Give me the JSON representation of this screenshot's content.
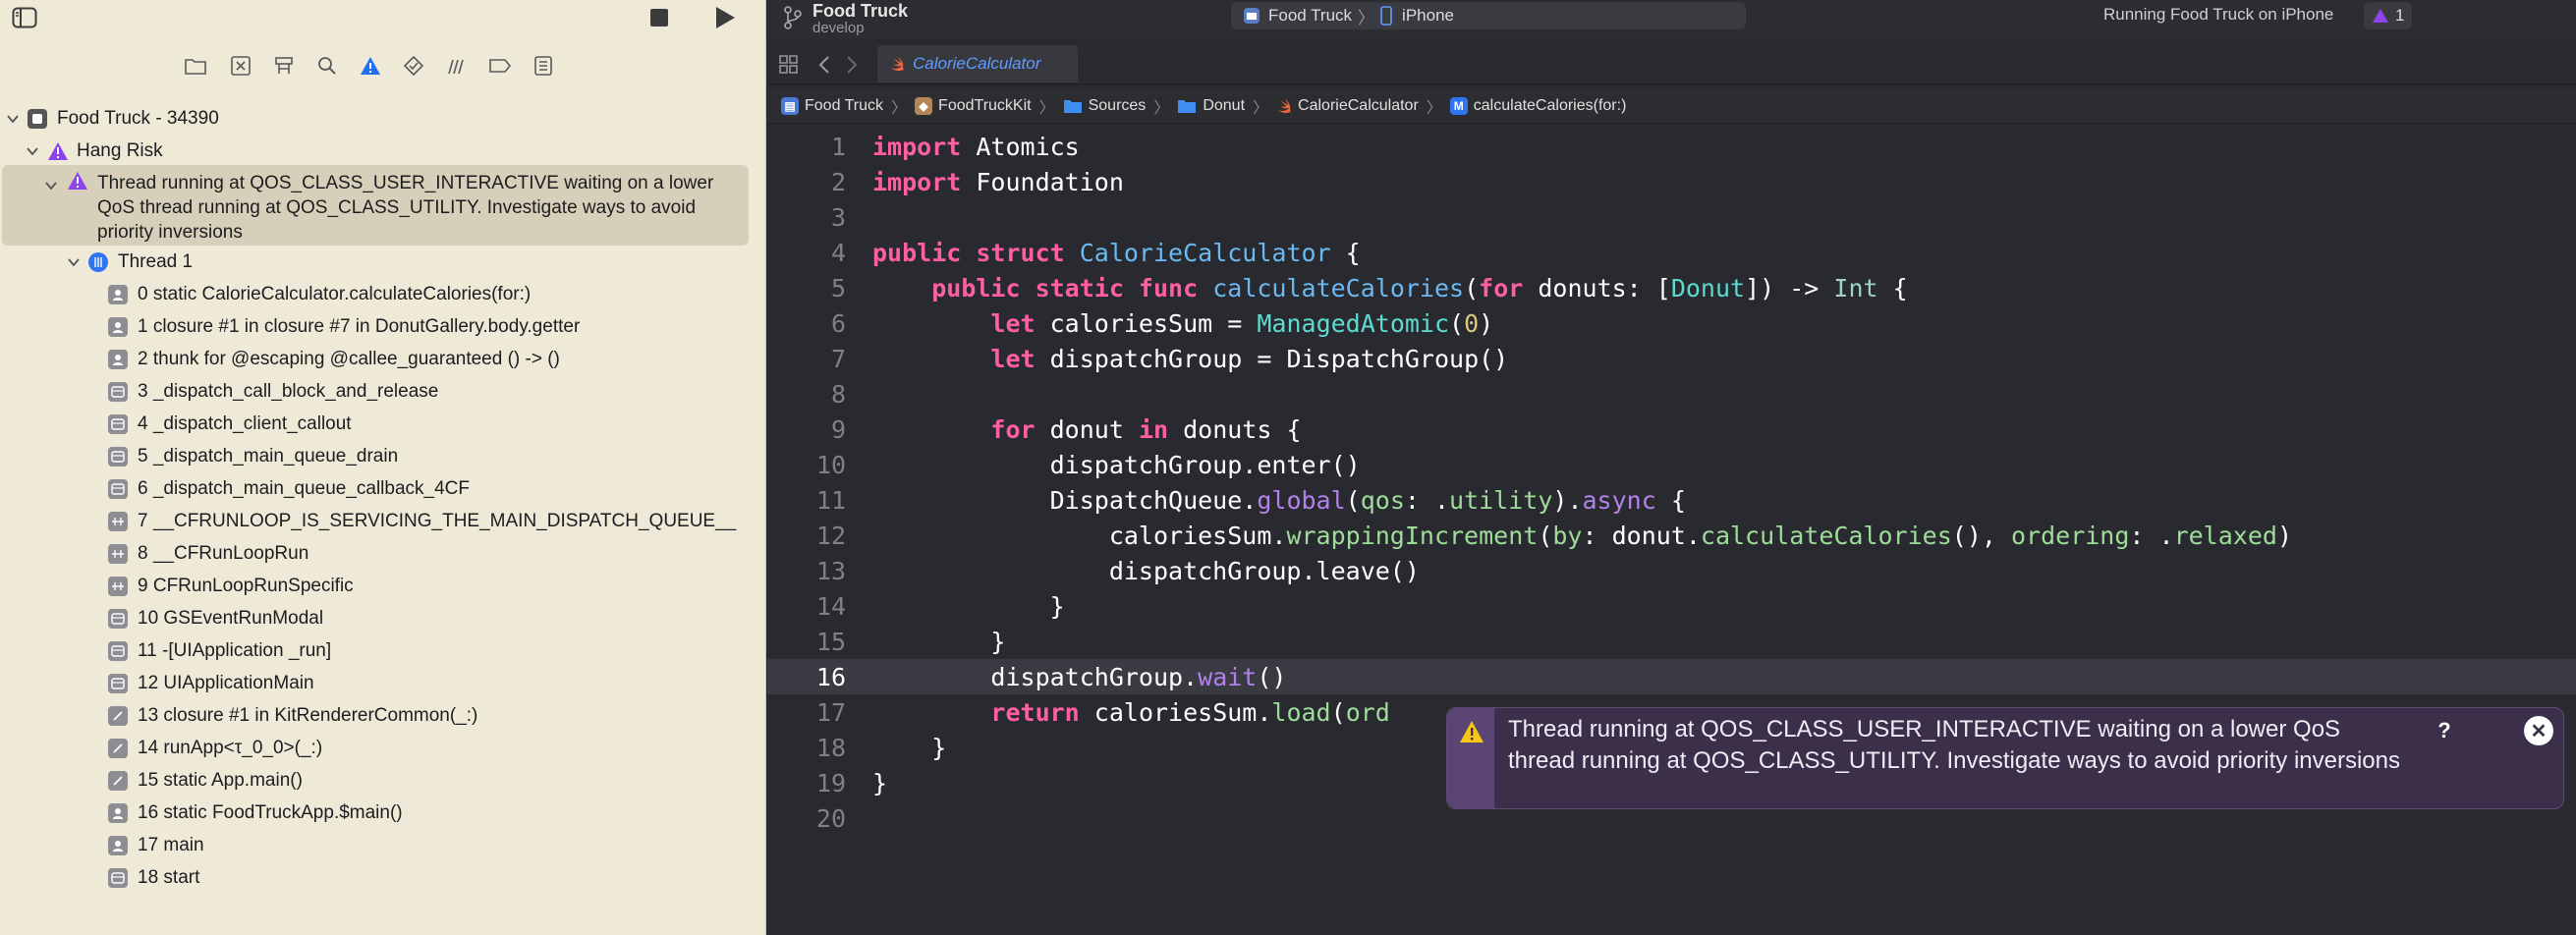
{
  "toolbar": {
    "project_name": "Food Truck",
    "branch": "develop",
    "scheme": "Food Truck",
    "destination": "iPhone",
    "status": "Running Food Truck on iPhone",
    "issue_count": "1"
  },
  "navigator": {
    "process": "Food Truck - 34390",
    "category": "Hang Risk",
    "issue": "Thread running at QOS_CLASS_USER_INTERACTIVE waiting on a lower QoS thread running at QOS_CLASS_UTILITY. Investigate ways to avoid priority inversions",
    "thread": "Thread 1",
    "frames": [
      {
        "label": "0 static CalorieCalculator.calculateCalories(for:)",
        "icon": "user-code-icon"
      },
      {
        "label": "1 closure #1 in closure #7 in DonutGallery.body.getter",
        "icon": "user-code-icon"
      },
      {
        "label": "2 thunk for @escaping @callee_guaranteed () -> ()",
        "icon": "user-code-icon"
      },
      {
        "label": "3 _dispatch_call_block_and_release",
        "icon": "library-icon"
      },
      {
        "label": "4 _dispatch_client_callout",
        "icon": "library-icon"
      },
      {
        "label": "5 _dispatch_main_queue_drain",
        "icon": "library-icon"
      },
      {
        "label": "6 _dispatch_main_queue_callback_4CF",
        "icon": "library-icon"
      },
      {
        "label": "7 __CFRUNLOOP_IS_SERVICING_THE_MAIN_DISPATCH_QUEUE__",
        "icon": "framework-icon"
      },
      {
        "label": "8 __CFRunLoopRun",
        "icon": "framework-icon"
      },
      {
        "label": "9 CFRunLoopRunSpecific",
        "icon": "framework-icon"
      },
      {
        "label": "10 GSEventRunModal",
        "icon": "library-icon"
      },
      {
        "label": "11 -[UIApplication _run]",
        "icon": "library-icon"
      },
      {
        "label": "12 UIApplicationMain",
        "icon": "library-icon"
      },
      {
        "label": "13 closure #1 in KitRendererCommon(_:)",
        "icon": "swiftui-icon"
      },
      {
        "label": "14 runApp<τ_0_0>(_:)",
        "icon": "swiftui-icon"
      },
      {
        "label": "15 static App.main()",
        "icon": "swiftui-icon"
      },
      {
        "label": "16 static FoodTruckApp.$main()",
        "icon": "user-code-icon"
      },
      {
        "label": "17 main",
        "icon": "user-code-icon"
      },
      {
        "label": "18 start",
        "icon": "library-icon"
      }
    ]
  },
  "editor": {
    "tab": "CalorieCalculator",
    "breadcrumb": [
      "Food Truck",
      "FoodTruckKit",
      "Sources",
      "Donut",
      "CalorieCalculator",
      "calculateCalories(for:)"
    ],
    "line_numbers": [
      "1",
      "2",
      "3",
      "4",
      "5",
      "6",
      "7",
      "8",
      "9",
      "10",
      "11",
      "12",
      "13",
      "14",
      "15",
      "16",
      "17",
      "18",
      "19",
      "20"
    ],
    "current_line": "16",
    "popover_text": "Thread running at QOS_CLASS_USER_INTERACTIVE waiting on a lower QoS thread running at QOS_CLASS_UTILITY. Investigate ways to avoid priority inversions",
    "popover_help": "?",
    "popover_close": "✕"
  },
  "colors": {
    "keyword": "#ff5fa2",
    "type": "#5ddbd0",
    "function": "#6bb9f0",
    "method": "#b281eb",
    "warning": "#8e44ec"
  }
}
